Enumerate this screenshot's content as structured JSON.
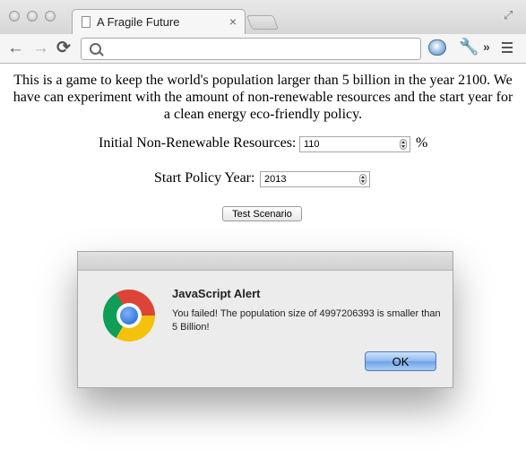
{
  "browser": {
    "tab_title": "A Fragile Future",
    "tab_close": "×",
    "address_value": "",
    "back_glyph": "←",
    "forward_glyph": "→",
    "reload_glyph": "⟳",
    "overflow_glyph": "»",
    "wrench_glyph": "🔧"
  },
  "page": {
    "intro": "This is a game to keep the world's population larger than 5 billion in the year 2100. We have can experiment with the amount of non-renewable resources and the start year for a clean energy eco-friendly policy.",
    "resources_label": "Initial Non-Renewable Resources:",
    "resources_value": "110",
    "resources_unit": "%",
    "policy_label": "Start Policy Year:",
    "policy_value": "2013",
    "test_button": "Test Scenario"
  },
  "dialog": {
    "title": "JavaScript Alert",
    "message": "You failed! The population size of 4997206393 is smaller than 5 Billion!",
    "ok_label": "OK"
  }
}
